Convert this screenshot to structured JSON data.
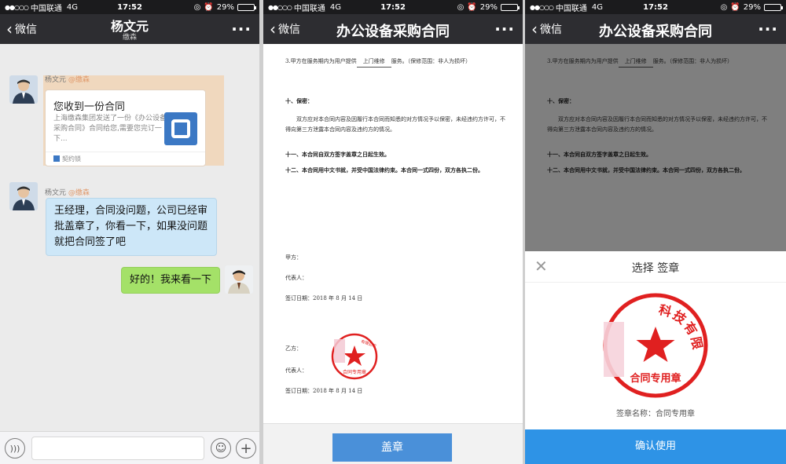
{
  "status": {
    "carrier": "中国联通",
    "network": "4G",
    "time": "17:52",
    "battery": "29%",
    "battery_level": 0.29
  },
  "chat": {
    "back_label": "微信",
    "title": "杨文元",
    "subtitle": "缴森",
    "sender1": "杨文元",
    "sender1_tag": "@缴森",
    "card": {
      "title": "您收到一份合同",
      "desc": "上海缴森集团发送了一份《办公设备采购合同》合同给您,需要您完订一下...",
      "footer": "契约锁"
    },
    "sender2": "杨文元",
    "sender2_tag": "@缴森",
    "msg_in": "王经理，合同没问题，公司已经审批盖章了，你看一下，如果没问题就把合同签了吧",
    "msg_out": "好的！我来看一下"
  },
  "doc": {
    "back_label": "微信",
    "title": "办公设备采购合同",
    "clause_3a": "3.甲方在服务期内为用户提供",
    "clause_3_blank": "上门维修",
    "clause_3b": "服务。（保修范围：非人为损坏）",
    "sec10": "十、保密：",
    "sec10_text": "双方应对本合同内容及因履行本合同而知悉的对方情况予以保密，未经违约方许可，不得向第三方泄露本合同内容及违约方的情况。",
    "sec11": "十一、本合同自双方签字盖章之日起生效。",
    "sec12": "十二、本合同用中文书就，并受中国法律约束。本合同一式四份，双方各执二份。",
    "party_a": "甲方：",
    "rep_a": "代表人：",
    "date_a": "签订日期：2018 年 8 月 14 日",
    "party_b": "乙方：",
    "rep_b": "代表人：",
    "date_b": "签订日期：2018 年 8 月 14 日",
    "seal_small_text": "有限公司",
    "seal_small_bottom": "合同专用章",
    "stamp_button": "盖章"
  },
  "picker": {
    "back_label": "微信",
    "title": "办公设备采购合同",
    "sheet_title": "选择 签章",
    "seal_text": "科技有限公司",
    "seal_bottom": "合同专用章",
    "seal_name": "签章名称：合同专用章",
    "confirm_button": "确认使用"
  },
  "colors": {
    "nav": "#2d2d31",
    "seal": "#e02020",
    "bubble_in": "#cde7f8",
    "bubble_out": "#a4e168",
    "primary": "#2e93e6"
  }
}
